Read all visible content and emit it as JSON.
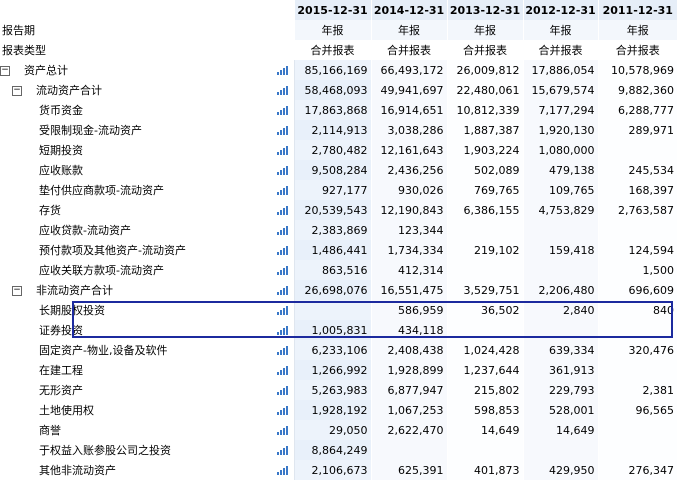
{
  "header": {
    "dates": [
      "2015-12-31",
      "2014-12-31",
      "2013-12-31",
      "2012-12-31",
      "2011-12-31"
    ],
    "period_label": "报告期",
    "period_values": [
      "年报",
      "年报",
      "年报",
      "年报",
      "年报"
    ],
    "type_label": "报表类型",
    "type_values": [
      "合并报表",
      "合并报表",
      "合并报表",
      "合并报表",
      "合并报表"
    ]
  },
  "rows": [
    {
      "label": "资产总计",
      "values": [
        "85,166,169",
        "66,493,172",
        "26,009,812",
        "17,886,054",
        "10,578,969"
      ]
    },
    {
      "label": "流动资产合计",
      "values": [
        "58,468,093",
        "49,941,697",
        "22,480,061",
        "15,679,574",
        "9,882,360"
      ]
    },
    {
      "label": "货币资金",
      "values": [
        "17,863,868",
        "16,914,651",
        "10,812,339",
        "7,177,294",
        "6,288,777"
      ]
    },
    {
      "label": "受限制现金-流动资产",
      "values": [
        "2,114,913",
        "3,038,286",
        "1,887,387",
        "1,920,130",
        "289,971"
      ]
    },
    {
      "label": "短期投资",
      "values": [
        "2,780,482",
        "12,161,643",
        "1,903,224",
        "1,080,000",
        ""
      ]
    },
    {
      "label": "应收账款",
      "values": [
        "9,508,284",
        "2,436,256",
        "502,089",
        "479,138",
        "245,534"
      ]
    },
    {
      "label": "垫付供应商款项-流动资产",
      "values": [
        "927,177",
        "930,026",
        "769,765",
        "109,765",
        "168,397"
      ]
    },
    {
      "label": "存货",
      "values": [
        "20,539,543",
        "12,190,843",
        "6,386,155",
        "4,753,829",
        "2,763,587"
      ]
    },
    {
      "label": "应收贷款-流动资产",
      "values": [
        "2,383,869",
        "123,344",
        "",
        "",
        ""
      ]
    },
    {
      "label": "预付款项及其他资产-流动资产",
      "values": [
        "1,486,441",
        "1,734,334",
        "219,102",
        "159,418",
        "124,594"
      ]
    },
    {
      "label": "应收关联方款项-流动资产",
      "values": [
        "863,516",
        "412,314",
        "",
        "",
        "1,500"
      ]
    },
    {
      "label": "非流动资产合计",
      "values": [
        "26,698,076",
        "16,551,475",
        "3,529,751",
        "2,206,480",
        "696,609"
      ]
    },
    {
      "label": "长期股权投资",
      "values": [
        "",
        "586,959",
        "36,502",
        "2,840",
        "840"
      ]
    },
    {
      "label": "证券投资",
      "values": [
        "1,005,831",
        "434,118",
        "",
        "",
        ""
      ]
    },
    {
      "label": "固定资产-物业,设备及软件",
      "values": [
        "6,233,106",
        "2,408,438",
        "1,024,428",
        "639,334",
        "320,476"
      ]
    },
    {
      "label": "在建工程",
      "values": [
        "1,266,992",
        "1,928,899",
        "1,237,644",
        "361,913",
        ""
      ]
    },
    {
      "label": "无形资产",
      "values": [
        "5,263,983",
        "6,877,947",
        "215,802",
        "229,793",
        "2,381"
      ]
    },
    {
      "label": "土地使用权",
      "values": [
        "1,928,192",
        "1,067,253",
        "598,853",
        "528,001",
        "96,565"
      ]
    },
    {
      "label": "商誉",
      "values": [
        "29,050",
        "2,622,470",
        "14,649",
        "14,649",
        ""
      ]
    },
    {
      "label": "于权益入账参股公司之投资",
      "values": [
        "8,864,249",
        "",
        "",
        "",
        ""
      ]
    },
    {
      "label": "其他非流动资产",
      "values": [
        "2,106,673",
        "625,391",
        "401,873",
        "429,950",
        "276,347"
      ]
    }
  ],
  "toggle_symbol": "−",
  "colors": {
    "highlight_border": "#1c2a9e",
    "chart_icon": "#3a78c7",
    "header_bg": "#e6eef8"
  }
}
